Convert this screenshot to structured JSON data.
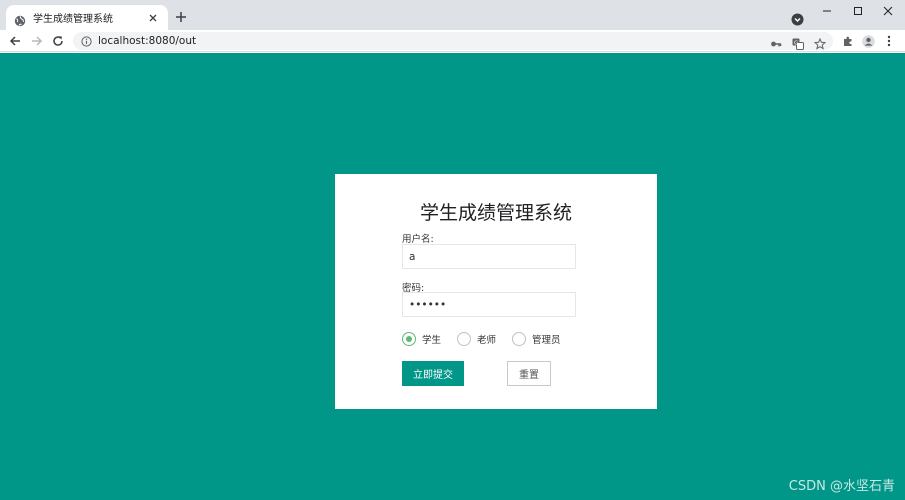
{
  "browser": {
    "tab": {
      "title": "学生成绩管理系统"
    },
    "url": "localhost:8080/out"
  },
  "page": {
    "title": "学生成绩管理系统",
    "username": {
      "label": "用户名:",
      "value": "a"
    },
    "password": {
      "label": "密码:",
      "value": "••••••"
    },
    "roles": [
      {
        "label": "学生",
        "checked": true
      },
      {
        "label": "老师",
        "checked": false
      },
      {
        "label": "管理员",
        "checked": false
      }
    ],
    "submit_label": "立即提交",
    "reset_label": "重置"
  },
  "watermark": "CSDN @水坚石青",
  "colors": {
    "page_background": "#009688",
    "primary_button": "#009688",
    "radio_checked": "#5fb878"
  }
}
